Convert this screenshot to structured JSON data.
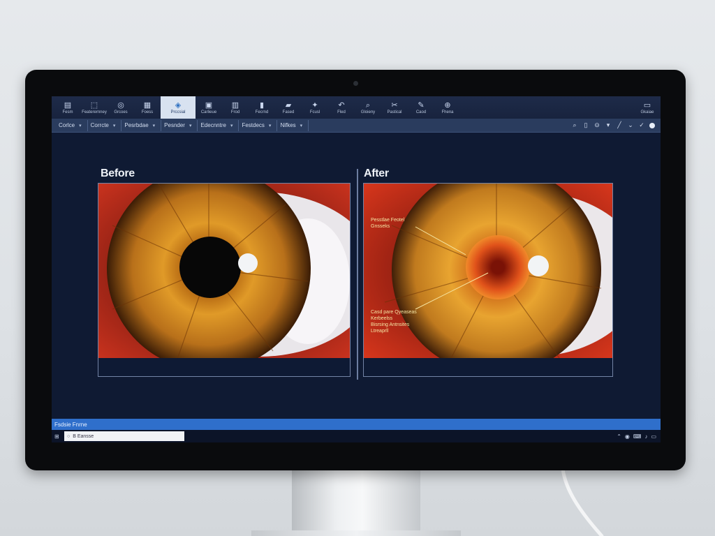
{
  "ribbon": {
    "buttons": [
      {
        "icon": "▤",
        "label": "Fesm",
        "icon_name": "grid-icon"
      },
      {
        "icon": "⬚",
        "label": "Featerernney",
        "icon_name": "layers-icon"
      },
      {
        "icon": "◎",
        "label": "Grcoes",
        "icon_name": "target-icon"
      },
      {
        "icon": "▦",
        "label": "Foess",
        "icon_name": "table-icon"
      },
      {
        "icon": "◈",
        "label": "Prccsial",
        "icon_name": "diamond-icon",
        "active": true
      },
      {
        "icon": "▣",
        "label": "Carlieue",
        "icon_name": "square-icon"
      },
      {
        "icon": "▥",
        "label": "Frod",
        "icon_name": "columns-icon"
      },
      {
        "icon": "▮",
        "label": "Fecrnd",
        "icon_name": "bar-icon"
      },
      {
        "icon": "▰",
        "label": "Fased",
        "icon_name": "folder-icon"
      },
      {
        "icon": "✦",
        "label": "Fcusl",
        "icon_name": "spark-icon"
      },
      {
        "icon": "↶",
        "label": "Fled",
        "icon_name": "undo-icon"
      },
      {
        "icon": "⌕",
        "label": "Gloieny",
        "icon_name": "magnify-icon"
      },
      {
        "icon": "✂",
        "label": "Pastical",
        "icon_name": "cut-icon"
      },
      {
        "icon": "✎",
        "label": "Caod",
        "icon_name": "pen-icon"
      },
      {
        "icon": "⊕",
        "label": "Fhena",
        "icon_name": "globe-icon"
      }
    ],
    "right": {
      "icon": "▭",
      "label": "Gkaiae",
      "icon_name": "monitor-icon"
    }
  },
  "toolbar": {
    "dropdowns": [
      "Corlce",
      "Corrcte",
      "Pesrbdae",
      "Pesnder",
      "Edecnntre",
      "Festdecs",
      "Nifkes"
    ],
    "tools": [
      "⌕",
      "▯",
      "⊝",
      "▾",
      "╱",
      "⌄",
      "✓"
    ]
  },
  "canvas": {
    "before_label": "Before",
    "after_label": "After",
    "annotation_top": [
      "Pesstlae Feotel",
      "Gnsseks"
    ],
    "annotation_bottom": [
      "Casd pare Qyeaseas",
      "Kerbeelss",
      "Bisrsing Antnsites",
      "Ltreaprll"
    ]
  },
  "status_bar": {
    "text": "Fsdsie Fnrne"
  },
  "taskbar": {
    "start_icon": "⊞",
    "search_text": "B Eansse",
    "tray": [
      "⌃",
      "◉",
      "⌨",
      "♪",
      "▭"
    ]
  },
  "colors": {
    "accent": "#2f6fcb",
    "screen_bg": "#0f1a33",
    "annotation": "#f6e6a4"
  }
}
